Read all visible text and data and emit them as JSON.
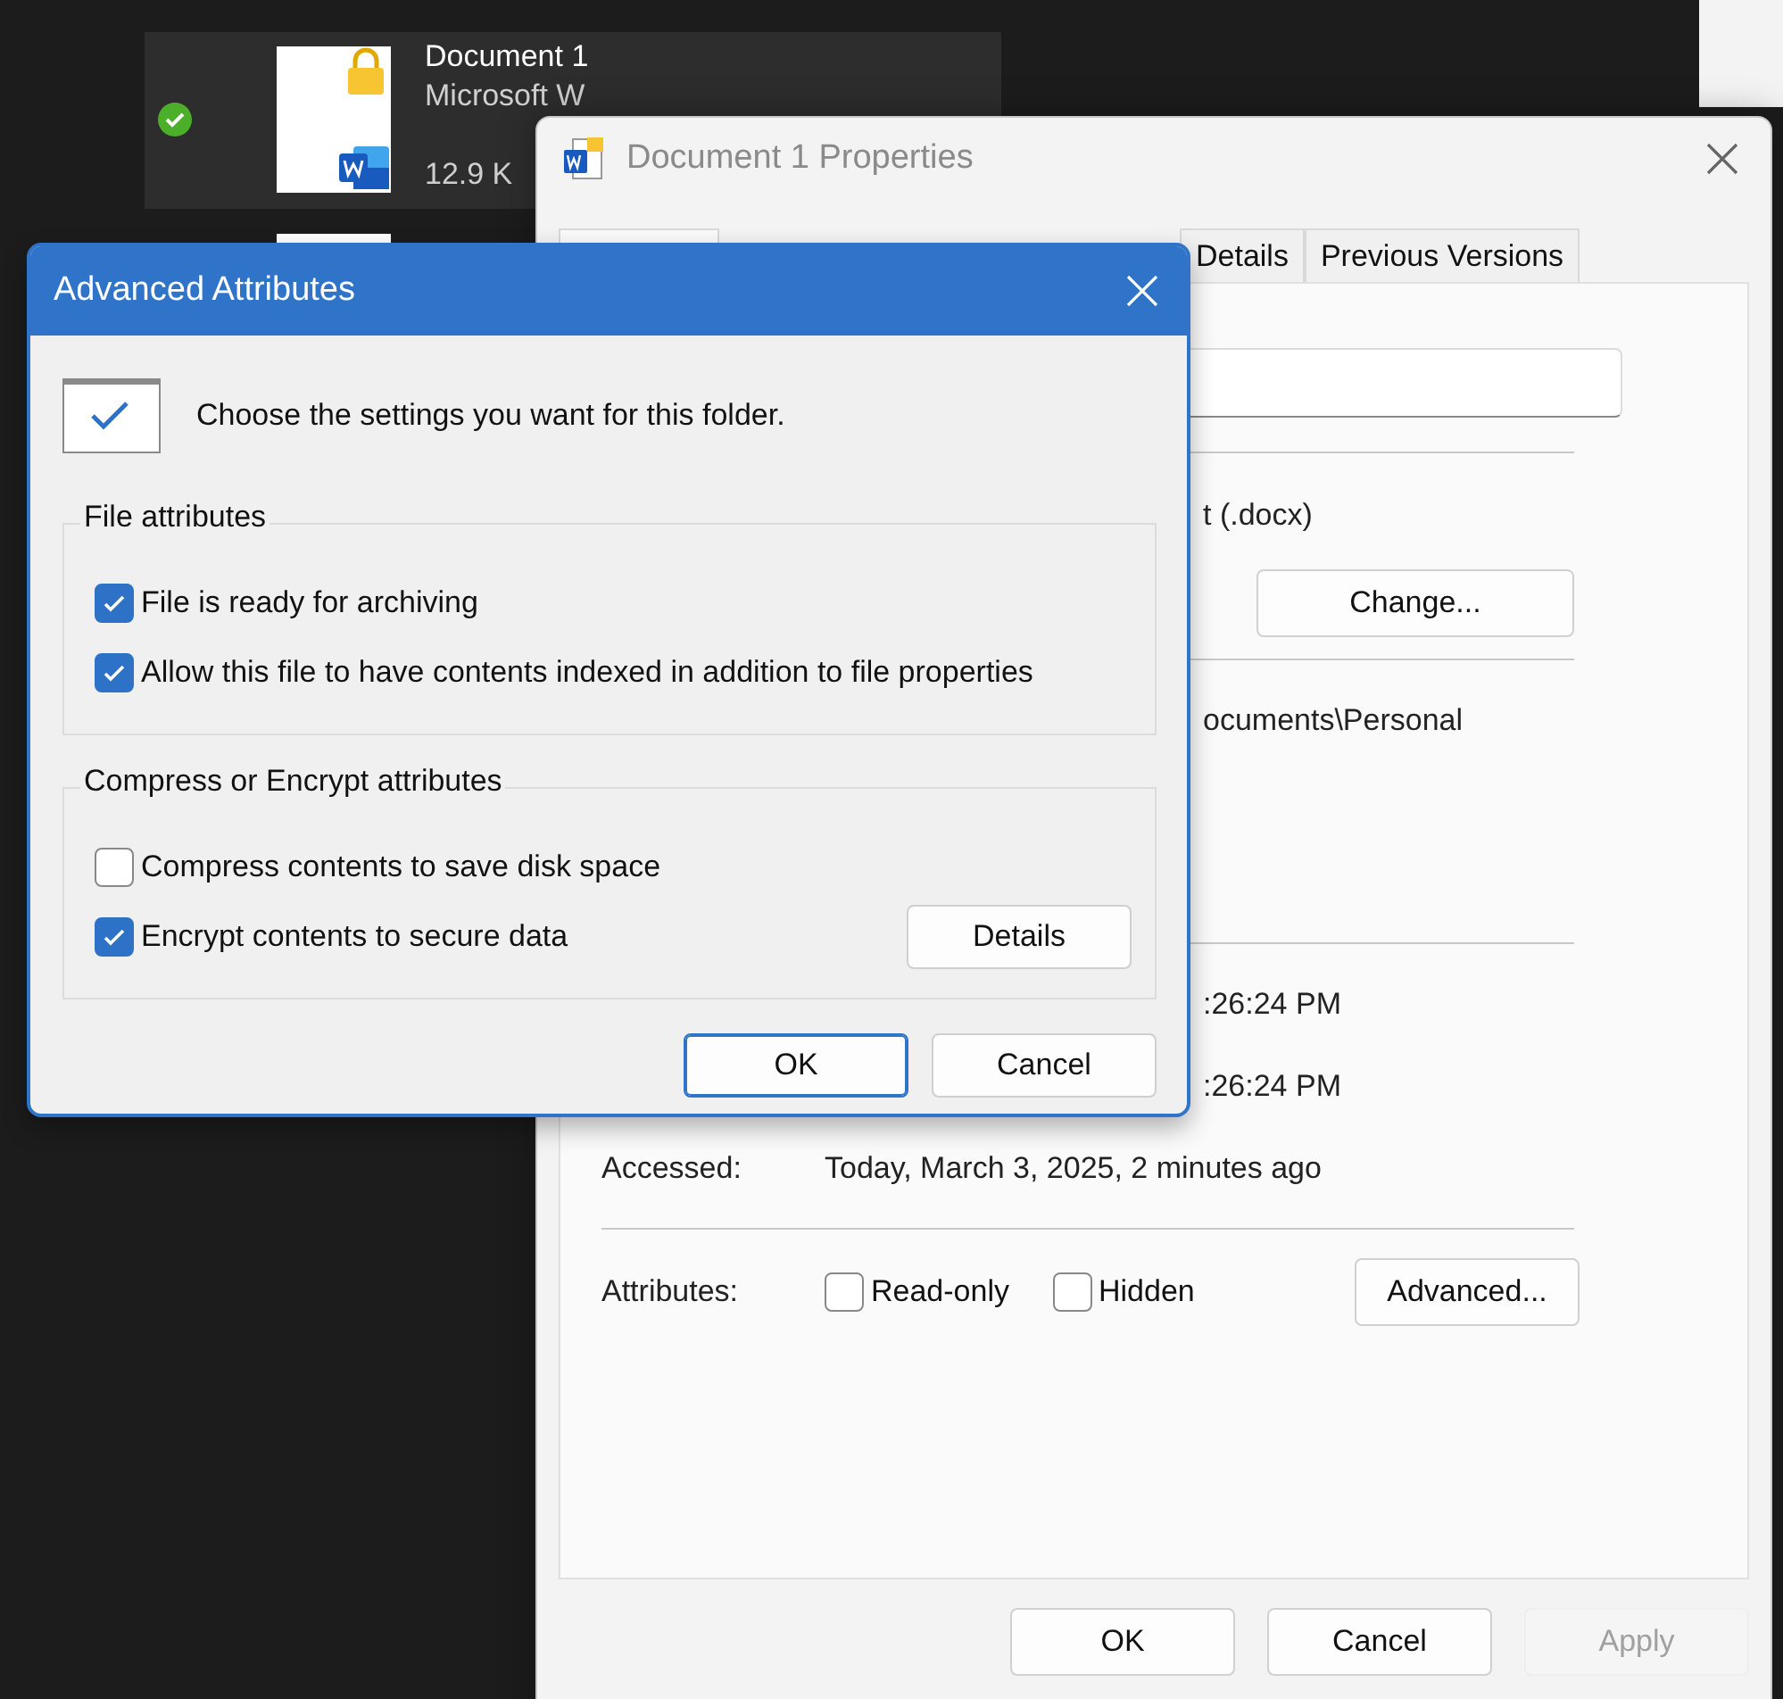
{
  "explorer": {
    "file": {
      "name": "Document 1",
      "type": "Microsoft W",
      "size": "12.9 K",
      "synced": true
    }
  },
  "properties": {
    "title": "Document 1 Properties",
    "tabs": [
      {
        "label": "Details",
        "selected": false
      },
      {
        "label": "Previous Versions",
        "selected": false
      }
    ],
    "type_value": "t (.docx)",
    "change_button": "Change...",
    "location_value": "ocuments\\Personal",
    "created_value": ":26:24 PM",
    "modified_value": ":26:24 PM",
    "accessed_label": "Accessed:",
    "accessed_value": "Today, March 3, 2025, 2 minutes ago",
    "attributes_label": "Attributes:",
    "attributes": [
      {
        "label": "Read-only",
        "checked": false
      },
      {
        "label": "Hidden",
        "checked": false
      }
    ],
    "advanced_button": "Advanced...",
    "buttons": [
      {
        "label": "OK",
        "disabled": false
      },
      {
        "label": "Cancel",
        "disabled": false
      },
      {
        "label": "Apply",
        "disabled": true
      }
    ]
  },
  "advanced_dialog": {
    "title": "Advanced Attributes",
    "intro": "Choose the settings you want for this folder.",
    "groups": [
      {
        "title": "File attributes",
        "options": [
          {
            "label": "File is ready for archiving",
            "checked": true
          },
          {
            "label": "Allow this file to have contents indexed in addition to file properties",
            "checked": true
          }
        ]
      },
      {
        "title": "Compress or Encrypt attributes",
        "options": [
          {
            "label": "Compress contents to save disk space",
            "checked": false
          },
          {
            "label": "Encrypt contents to secure data",
            "checked": true
          }
        ],
        "details_button": "Details"
      }
    ],
    "buttons": [
      {
        "label": "OK",
        "default": true
      },
      {
        "label": "Cancel",
        "default": false
      }
    ]
  }
}
